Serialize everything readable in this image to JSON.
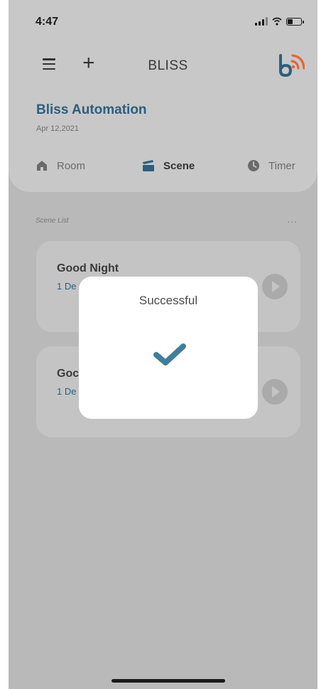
{
  "status_bar": {
    "time": "4:47"
  },
  "header": {
    "title": "BLISS"
  },
  "organization": {
    "name": "Bliss Automation",
    "date": "Apr 12,2021"
  },
  "tabs": [
    {
      "label": "Room",
      "icon": "home-icon",
      "active": false
    },
    {
      "label": "Scene",
      "icon": "clapper-icon",
      "active": true
    },
    {
      "label": "Timer",
      "icon": "clock-icon",
      "active": false
    }
  ],
  "scene_list": {
    "label": "Scene List",
    "more": "...",
    "items": [
      {
        "name": "Good Night",
        "devices": "1 De"
      },
      {
        "name": "Goc",
        "devices": "1 De"
      }
    ]
  },
  "modal": {
    "title": "Successful",
    "icon": "check-icon"
  },
  "colors": {
    "accent": "#2c5f7e",
    "brand_orange": "#e8623a",
    "overlay": "#b9b9b9"
  }
}
